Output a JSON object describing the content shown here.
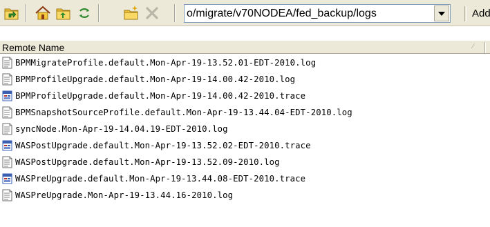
{
  "toolbar": {
    "buttons": [
      {
        "icon": "folder-up-icon"
      },
      {
        "icon": "home-folder-icon"
      },
      {
        "icon": "parent-folder-icon"
      },
      {
        "icon": "refresh-icon"
      },
      {
        "icon": "new-folder-icon"
      },
      {
        "icon": "delete-icon"
      }
    ],
    "path_value": "o/migrate/v70NODEA/fed_backup/logs",
    "add_label": "Add"
  },
  "list": {
    "column_header": "Remote Name",
    "rows": [
      {
        "name": "BPMMigrateProfile.default.Mon-Apr-19-13.52.01-EDT-2010.log",
        "type": "text"
      },
      {
        "name": "BPMProfileUpgrade.default.Mon-Apr-19-14.00.42-2010.log",
        "type": "text"
      },
      {
        "name": "BPMProfileUpgrade.default.Mon-Apr-19-14.00.42-2010.trace",
        "type": "trace"
      },
      {
        "name": "BPMSnapshotSourceProfile.default.Mon-Apr-19-13.44.04-EDT-2010.log",
        "type": "text"
      },
      {
        "name": "syncNode.Mon-Apr-19-14.04.19-EDT-2010.log",
        "type": "text"
      },
      {
        "name": "WASPostUpgrade.default.Mon-Apr-19-13.52.02-EDT-2010.trace",
        "type": "trace"
      },
      {
        "name": "WASPostUpgrade.default.Mon-Apr-19-13.52.09-2010.log",
        "type": "text"
      },
      {
        "name": "WASPreUpgrade.default.Mon-Apr-19-13.44.08-EDT-2010.trace",
        "type": "trace"
      },
      {
        "name": "WASPreUpgrade.Mon-Apr-19-13.44.16-2010.log",
        "type": "text"
      }
    ]
  },
  "colors": {
    "toolbar_bg": "#ece9d8",
    "folder_yellow": "#f5c73c",
    "trace_blue": "#3a5fb0"
  }
}
